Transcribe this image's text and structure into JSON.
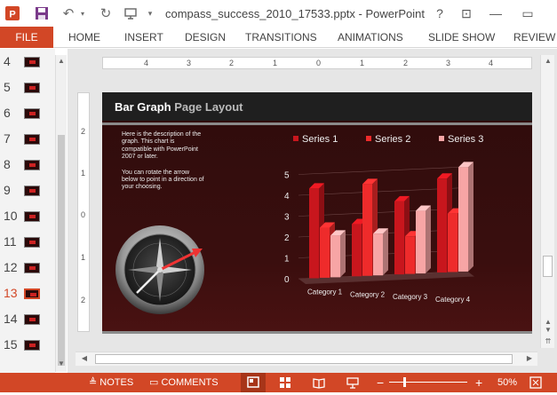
{
  "window": {
    "document_title": "compass_success_2010_17533.pptx - PowerPoint",
    "help": "?",
    "ribbon_display": "⊡",
    "minimize": "—",
    "restore": "▭"
  },
  "quick_access": {
    "save_icon": "save-icon",
    "undo_icon": "undo-icon",
    "redo_icon": "redo-icon",
    "presenter_icon": "presenter-icon",
    "dropdown_icon": "chevron-down-icon"
  },
  "ribbon": {
    "file": "FILE",
    "tabs": [
      "HOME",
      "INSERT",
      "DESIGN",
      "TRANSITIONS",
      "ANIMATIONS",
      "SLIDE SHOW",
      "REVIEW"
    ]
  },
  "thumbnails": [
    {
      "num": "4"
    },
    {
      "num": "5"
    },
    {
      "num": "6"
    },
    {
      "num": "7"
    },
    {
      "num": "8"
    },
    {
      "num": "9"
    },
    {
      "num": "10"
    },
    {
      "num": "11"
    },
    {
      "num": "12"
    },
    {
      "num": "13"
    },
    {
      "num": "14"
    },
    {
      "num": "15"
    }
  ],
  "active_slide": "13",
  "ruler": {
    "h_labels": [
      "4",
      "3",
      "2",
      "1",
      "0",
      "1",
      "2",
      "3",
      "4"
    ],
    "v_labels": [
      "2",
      "1",
      "0",
      "1",
      "2"
    ]
  },
  "slide": {
    "title_main": "Bar Graph",
    "title_sub": " Page Layout",
    "description_1": "Here is the description of the graph.  This chart is compatible with PowerPoint 2007 or later.",
    "description_2": "You can rotate the arrow below to point in a direction of your choosing."
  },
  "chart_data": {
    "type": "bar",
    "categories": [
      "Category 1",
      "Category 2",
      "Category 3",
      "Category 4"
    ],
    "series": [
      {
        "name": "Series 1",
        "values": [
          4.3,
          2.5,
          3.5,
          4.5
        ],
        "color": "#c8161d"
      },
      {
        "name": "Series 2",
        "values": [
          2.4,
          4.4,
          1.8,
          2.8
        ],
        "color": "#ee2b2b"
      },
      {
        "name": "Series 3",
        "values": [
          2.0,
          2.0,
          3.0,
          5.0
        ],
        "color": "#f7a5a5"
      }
    ],
    "yticks": [
      "0",
      "1",
      "2",
      "3",
      "4",
      "5"
    ],
    "ylim": [
      0,
      5
    ]
  },
  "status": {
    "notes": "NOTES",
    "comments": "COMMENTS",
    "zoom_minus": "−",
    "zoom_plus": "+",
    "zoom": "50%"
  },
  "colors": {
    "accent": "#d24726",
    "slide_bg": "#2e0c0c"
  }
}
